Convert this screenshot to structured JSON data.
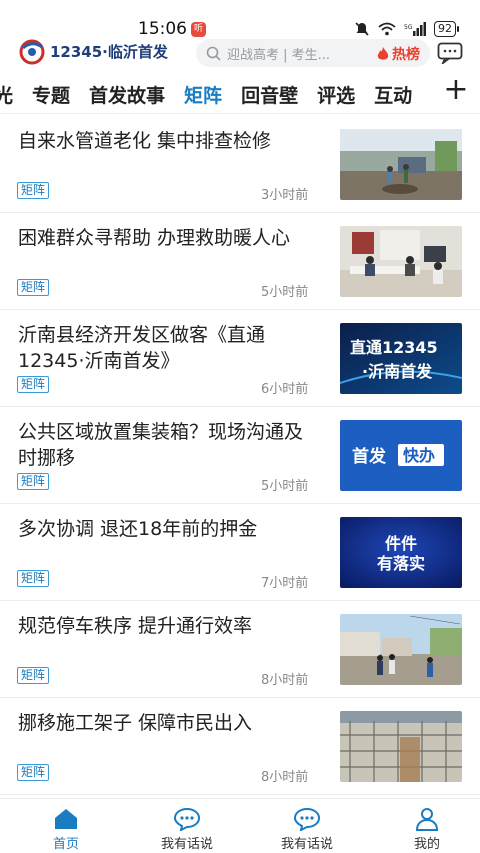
{
  "status": {
    "time": "15:06",
    "notif_badge": "听",
    "battery": "92"
  },
  "header": {
    "app_title": "12345·临沂首发",
    "search_placeholder": "迎战高考 | 考生...",
    "hot_label": "热榜"
  },
  "tabs": [
    "光",
    "专题",
    "首发故事",
    "矩阵",
    "回音壁",
    "评选",
    "互动"
  ],
  "active_tab": "矩阵",
  "items": [
    {
      "title": "自来水管道老化  集中排查检修",
      "tag": "矩阵",
      "time": "3小时前"
    },
    {
      "title": "困难群众寻帮助    办理救助暖人心",
      "tag": "矩阵",
      "time": "5小时前"
    },
    {
      "title": "沂南县经济开发区做客《直通12345·沂南首发》",
      "tag": "矩阵",
      "time": "6小时前"
    },
    {
      "title": "公共区域放置集装箱？现场沟通及时挪移",
      "tag": "矩阵",
      "time": "5小时前"
    },
    {
      "title": "多次协调  退还18年前的押金",
      "tag": "矩阵",
      "time": "7小时前"
    },
    {
      "title": "规范停车秩序  提升通行效率",
      "tag": "矩阵",
      "time": "8小时前"
    },
    {
      "title": "挪移施工架子  保障市民出入",
      "tag": "矩阵",
      "time": "8小时前"
    }
  ],
  "thumb_texts": {
    "t3": [
      "直通12345",
      "·沂南首发"
    ],
    "t4": [
      "首发",
      "快办"
    ],
    "t5": [
      "件件",
      "有落实"
    ]
  },
  "bottom_nav": [
    {
      "label": "首页",
      "icon": "home-icon"
    },
    {
      "label": "我有话说",
      "icon": "chat-icon"
    },
    {
      "label": "我有话说",
      "icon": "chat-icon"
    },
    {
      "label": "我的",
      "icon": "user-icon"
    }
  ],
  "colors": {
    "accent": "#1a7dc2",
    "hot": "#e8432f",
    "tag_border": "#3c9bd6"
  }
}
